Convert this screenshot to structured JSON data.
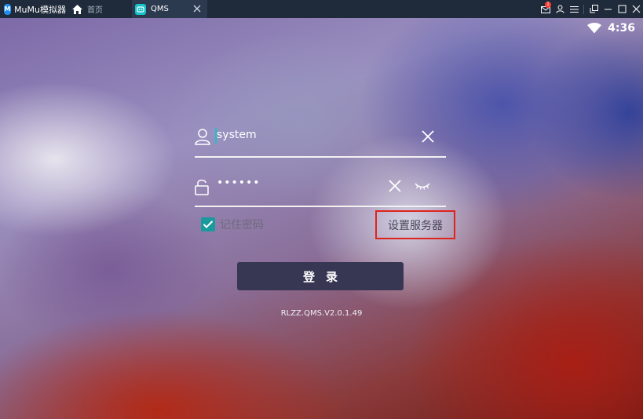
{
  "emulator": {
    "brand_name": "MuMu模拟器",
    "tabs": [
      {
        "label": "首页",
        "icon": "home-icon"
      },
      {
        "label": "QMS",
        "icon": "qms-app-icon"
      }
    ],
    "notification_count": "1",
    "controls": [
      "mail-icon",
      "user-icon",
      "menu-icon",
      "restore-icon",
      "minimize-icon",
      "maximize-icon",
      "close-icon"
    ]
  },
  "status_bar": {
    "time": "4:36",
    "icons": [
      "wifi-icon"
    ]
  },
  "login": {
    "username_value": "system",
    "password_value": "••••••",
    "remember_label": "记住密码",
    "remember_checked": true,
    "server_button_label": "设置服务器",
    "login_button_label": "登录",
    "version": "RLZZ.QMS.V2.0.1.49"
  },
  "colors": {
    "accent": "#1a9a9c",
    "highlight_border": "#e0231c",
    "login_button": "#373653"
  }
}
